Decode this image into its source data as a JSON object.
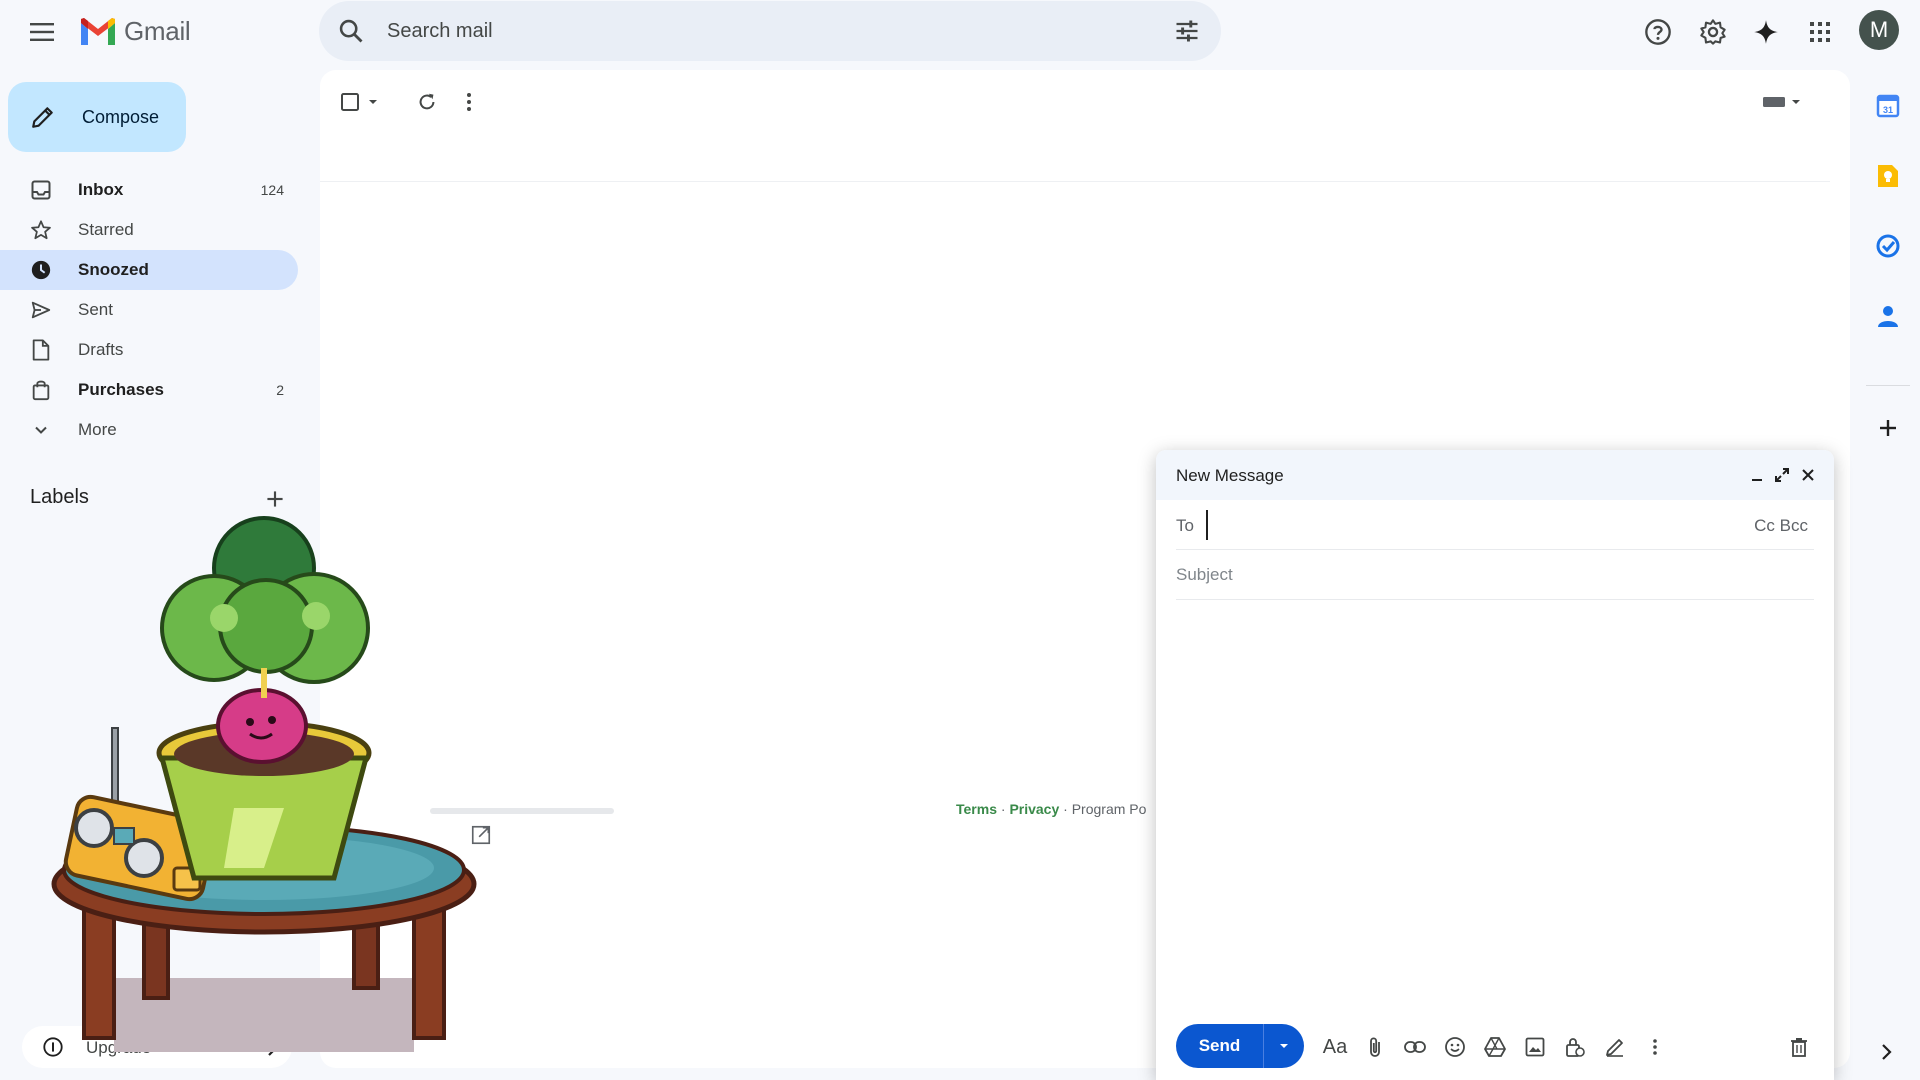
{
  "app": {
    "name": "Gmail"
  },
  "search": {
    "placeholder": "Search mail"
  },
  "header": {
    "avatar_letter": "M"
  },
  "compose_button": {
    "label": "Compose"
  },
  "sidebar": {
    "items": [
      {
        "label": "Inbox",
        "count": "124",
        "icon": "inbox-icon",
        "bold": true
      },
      {
        "label": "Starred",
        "count": "",
        "icon": "star-icon",
        "bold": false
      },
      {
        "label": "Snoozed",
        "count": "",
        "icon": "clock-icon",
        "bold": true,
        "active": true
      },
      {
        "label": "Sent",
        "count": "",
        "icon": "send-icon",
        "bold": false
      },
      {
        "label": "Drafts",
        "count": "",
        "icon": "draft-icon",
        "bold": false
      },
      {
        "label": "Purchases",
        "count": "2",
        "icon": "shopping-bag-icon",
        "bold": true
      },
      {
        "label": "More",
        "count": "",
        "icon": "chevron-down-icon",
        "bold": false
      }
    ],
    "labels_heading": "Labels"
  },
  "footer": {
    "terms": "Terms",
    "privacy": "Privacy",
    "program": "Program Po",
    "sep": "·"
  },
  "compose_window": {
    "title": "New Message",
    "to_label": "To",
    "cc_bcc": "Cc Bcc",
    "subject_placeholder": "Subject",
    "send_label": "Send",
    "format_label": "Aa"
  },
  "upgrade": {
    "label": "Upgrade"
  },
  "colors": {
    "accent": "#0b57d0",
    "compose_bg": "#c2e7ff",
    "active_nav": "#d3e3fd",
    "page_bg": "#f6f8fc"
  }
}
